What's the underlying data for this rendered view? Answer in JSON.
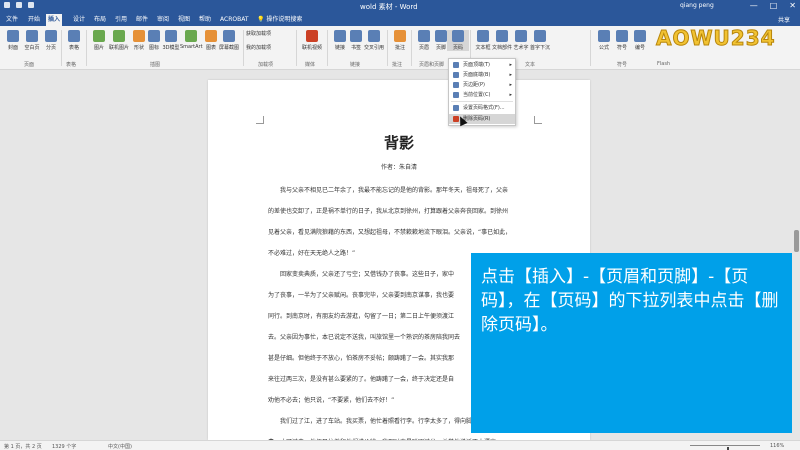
{
  "window": {
    "title": "wold 素材 - Word",
    "user": "qiang peng",
    "min": "—",
    "max": "□",
    "close": "✕"
  },
  "tabs": [
    "文件",
    "开始",
    "插入",
    "设计",
    "布局",
    "引用",
    "邮件",
    "审阅",
    "视图",
    "帮助",
    "ACROBAT"
  ],
  "active_tab": "插入",
  "tell_me": "操作说明搜索",
  "share": "共享",
  "ribbon": {
    "buttons": [
      "封面",
      "空白页",
      "分页",
      "表格",
      "图片",
      "联机图片",
      "形状",
      "图标",
      "3D模型",
      "SmartArt",
      "图表",
      "屏幕截图",
      "获取加载项",
      "我的加载项",
      "联机视频",
      "链接",
      "书签",
      "交叉引用",
      "批注",
      "页眉",
      "页脚",
      "页码",
      "文本框",
      "文档部件",
      "艺术字",
      "首字下沉",
      "公式",
      "符号",
      "编号"
    ],
    "groups": [
      "页面",
      "表格",
      "插图",
      "加载项",
      "媒体",
      "链接",
      "批注",
      "页眉和页脚",
      "文本",
      "符号",
      "Flash"
    ]
  },
  "logo_text": "AOWU234",
  "dropdown": {
    "items": [
      {
        "label": "页面顶端(T)",
        "arrow": "▸"
      },
      {
        "label": "页面底端(B)",
        "arrow": "▸"
      },
      {
        "label": "页边距(P)",
        "arrow": "▸"
      },
      {
        "label": "当前位置(C)",
        "arrow": "▸"
      },
      {
        "label": "设置页码格式(F)...",
        "arrow": ""
      },
      {
        "label": "删除页码(R)",
        "arrow": ""
      }
    ]
  },
  "document": {
    "heading": "背影",
    "author": "作者：朱自清",
    "paragraphs": [
      [
        "我与父亲不相见已二年余了，我最不能忘记的是他的背影。那年冬天，祖母死了，父亲",
        "的差使也交卸了，正是祸不单行的日子，我从北京到徐州，打算跟着父亲奔丧回家。到徐州",
        "见着父亲，看见满院狼藉的东西，又想起祖母，不禁簌簌地流下眼泪。父亲说，“事已如此，",
        "不必难过，好在天无绝人之路！”"
      ],
      [
        "回家变卖典质，父亲还了亏空；又借钱办了丧事。这些日子，家中",
        "为了丧事，一半为了父亲赋闲。丧事完毕，父亲要到南京谋事，我也要",
        "同行。到南京时，有朋友约去游逛，勾留了一日；第二日上午便须渡江",
        "去。父亲因为事忙，本已说定不送我，叫旅馆里一个熟识的茶房陪我同去",
        "甚是仔细。但他终于不放心，怕茶房不妥帖；颇踌躇了一会。其实我那",
        "来往过两三次，是没有甚么要紧的了。他踌躇了一会，终于决定还是自",
        "劝他不必去；他只说，“不要紧，他们去不好！”"
      ],
      [
        "我们过了江，进了车站。我买票，他忙着照看行李。行李太多了，得向脚夫行些小",
        "费，才可过去。他便又忙着和他们讲价钱。我那时真是聪明过分，总觉他说话不大漂亮，"
      ]
    ]
  },
  "callout": "点击【插入】-【页眉和页脚】-【页码】，在【页码】的下拉列表中点击【删除页码】。",
  "status": {
    "page": "第 1 页，共 2 页",
    "words": "1329 个字",
    "lang": "中文(中国)",
    "zoom": "116%",
    "zoom_fraction": 0.55
  }
}
